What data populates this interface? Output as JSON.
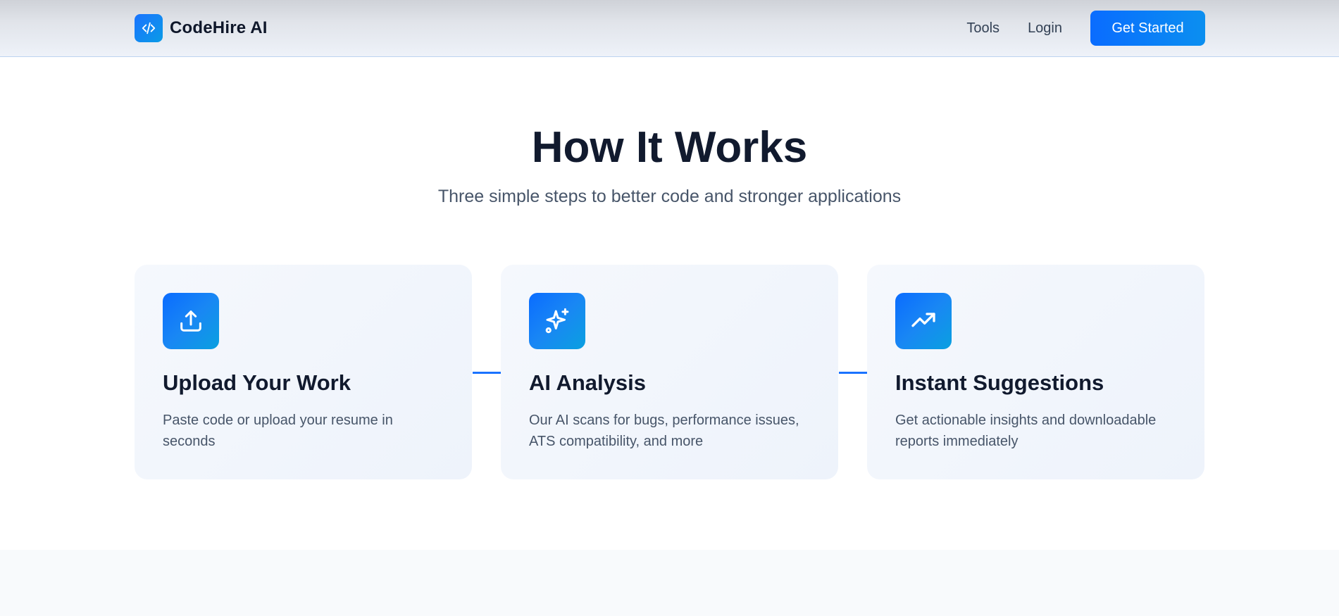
{
  "header": {
    "brand_name": "CodeHire AI",
    "logo_icon": "code-icon",
    "nav": [
      {
        "label": "Tools"
      },
      {
        "label": "Login"
      }
    ],
    "cta_label": "Get Started"
  },
  "section": {
    "title": "How It Works",
    "subtitle": "Three simple steps to better code and stronger applications"
  },
  "steps": [
    {
      "icon": "upload-icon",
      "title": "Upload Your Work",
      "description": "Paste code or upload your resume in seconds"
    },
    {
      "icon": "sparkles-icon",
      "title": "AI Analysis",
      "description": "Our AI scans for bugs, performance issues, ATS compatibility, and more"
    },
    {
      "icon": "trending-up-icon",
      "title": "Instant Suggestions",
      "description": "Get actionable insights and downloadable reports immediately"
    }
  ],
  "colors": {
    "accent": "#0a6cff",
    "accent_secondary": "#0aa0e0",
    "heading": "#111a2e",
    "body_text": "#475569",
    "card_background": "#f2f6fc"
  }
}
